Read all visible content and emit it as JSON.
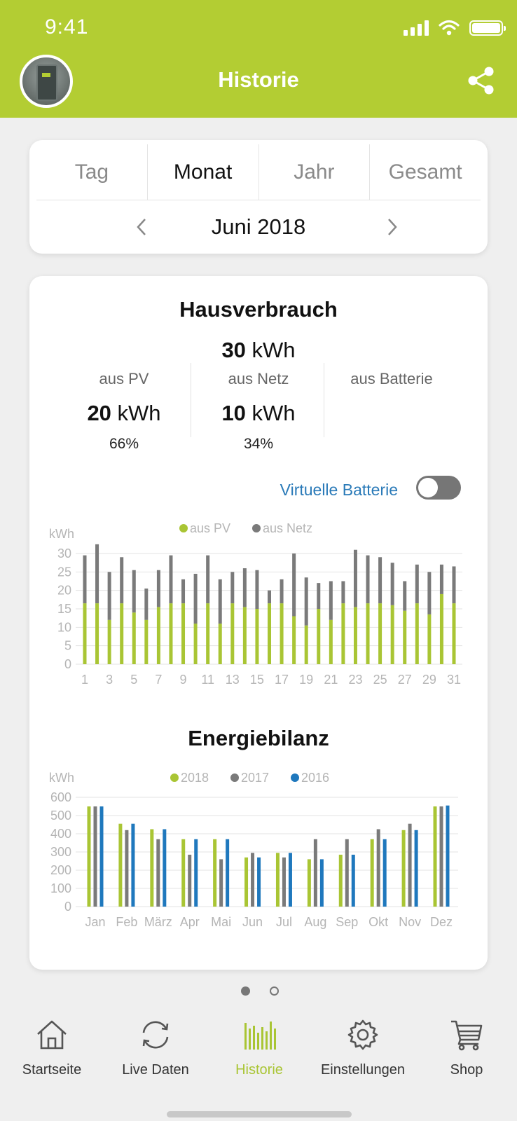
{
  "status": {
    "time": "9:41"
  },
  "header": {
    "title": "Historie"
  },
  "period": {
    "tabs": [
      "Tag",
      "Monat",
      "Jahr",
      "Gesamt"
    ],
    "active_tab": "Monat",
    "current": "Juni 2018"
  },
  "summary": {
    "title": "Hausverbrauch",
    "total_value": "30",
    "total_unit": "kWh",
    "pv": {
      "label": "aus PV",
      "value": "20",
      "unit": "kWh",
      "percent": "66%"
    },
    "netz": {
      "label": "aus Netz",
      "value": "10",
      "unit": "kWh",
      "percent": "34%"
    },
    "batterie": {
      "label": "aus Batterie"
    }
  },
  "virtual_battery": {
    "label": "Virtuelle Batterie",
    "enabled": false
  },
  "chart_data": [
    {
      "type": "bar",
      "stacked": true,
      "ylabel": "kWh",
      "ylim": [
        0,
        30
      ],
      "yticks": [
        0,
        5,
        10,
        15,
        20,
        25,
        30
      ],
      "x": [
        1,
        2,
        3,
        4,
        5,
        6,
        7,
        8,
        9,
        10,
        11,
        12,
        13,
        14,
        15,
        16,
        17,
        18,
        19,
        20,
        21,
        22,
        23,
        24,
        25,
        26,
        27,
        28,
        29,
        30,
        31
      ],
      "xtick_labels": [
        "1",
        "3",
        "5",
        "7",
        "9",
        "11",
        "13",
        "15",
        "17",
        "19",
        "21",
        "23",
        "25",
        "27",
        "29",
        "31"
      ],
      "legend": "top-center",
      "series": [
        {
          "name": "aus PV",
          "color": "#a9c534",
          "values": [
            16.5,
            16.5,
            12,
            16.5,
            14,
            12,
            15.5,
            16.5,
            16.5,
            11,
            16.5,
            11,
            16.5,
            15.5,
            15,
            16.5,
            16.5,
            13,
            10.5,
            15,
            12,
            16.5,
            15.5,
            16.5,
            16.5,
            16,
            14.5,
            16.5,
            13.5,
            19,
            16.5
          ]
        },
        {
          "name": "aus Netz",
          "color": "#7a7a7a",
          "values": [
            13,
            16,
            13,
            12.5,
            11.5,
            8.5,
            10,
            13,
            6.5,
            13.5,
            13,
            12,
            8.5,
            10.5,
            10.5,
            3.5,
            6.5,
            17,
            13,
            7,
            10.5,
            6,
            15.5,
            13,
            12.5,
            11.5,
            8,
            10.5,
            11.5,
            8,
            10
          ]
        }
      ]
    },
    {
      "type": "bar",
      "title": "Energiebilanz",
      "ylabel": "kWh",
      "ylim": [
        0,
        600
      ],
      "yticks": [
        0,
        100,
        200,
        300,
        400,
        500,
        600
      ],
      "categories": [
        "Jan",
        "Feb",
        "März",
        "Apr",
        "Mai",
        "Jun",
        "Jul",
        "Aug",
        "Sep",
        "Okt",
        "Nov",
        "Dez"
      ],
      "legend": "top-center",
      "series": [
        {
          "name": "2018",
          "color": "#a9c534",
          "values": [
            550,
            455,
            425,
            370,
            370,
            270,
            295,
            260,
            285,
            370,
            420,
            550
          ]
        },
        {
          "name": "2017",
          "color": "#7a7a7a",
          "values": [
            550,
            420,
            370,
            285,
            260,
            295,
            270,
            370,
            370,
            425,
            455,
            550
          ]
        },
        {
          "name": "2016",
          "color": "#1f78bd",
          "values": [
            550,
            455,
            425,
            370,
            370,
            270,
            295,
            260,
            285,
            370,
            420,
            555
          ]
        }
      ]
    }
  ],
  "pager": {
    "pages": 2,
    "current": 1
  },
  "tabbar": {
    "items": [
      {
        "label": "Startseite",
        "icon": "home-icon"
      },
      {
        "label": "Live Daten",
        "icon": "refresh-icon"
      },
      {
        "label": "Historie",
        "icon": "history-chart-icon",
        "active": true
      },
      {
        "label": "Einstellungen",
        "icon": "gear-icon"
      },
      {
        "label": "Shop",
        "icon": "cart-icon"
      }
    ]
  }
}
